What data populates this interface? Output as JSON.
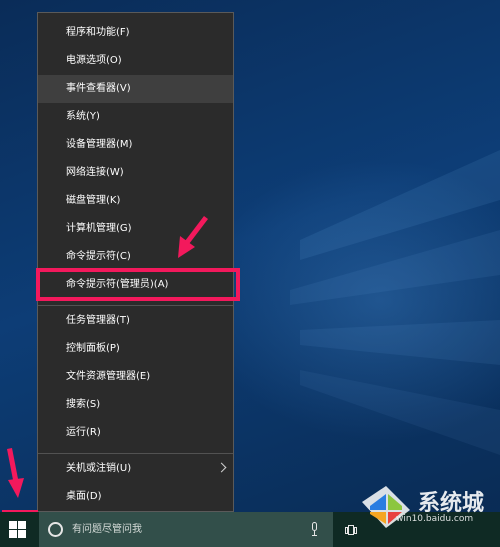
{
  "context_menu": {
    "items": [
      {
        "label": "程序和功能(F)"
      },
      {
        "label": "电源选项(O)"
      },
      {
        "label": "事件查看器(V)"
      },
      {
        "label": "系统(Y)"
      },
      {
        "label": "设备管理器(M)"
      },
      {
        "label": "网络连接(W)"
      },
      {
        "label": "磁盘管理(K)"
      },
      {
        "label": "计算机管理(G)"
      },
      {
        "label": "命令提示符(C)"
      },
      {
        "label": "命令提示符(管理员)(A)"
      },
      {
        "label": "任务管理器(T)"
      },
      {
        "label": "控制面板(P)"
      },
      {
        "label": "文件资源管理器(E)"
      },
      {
        "label": "搜索(S)"
      },
      {
        "label": "运行(R)"
      },
      {
        "label": "关机或注销(U)"
      },
      {
        "label": "桌面(D)"
      }
    ],
    "hovered_item": "事件查看器(V)",
    "highlighted_item": "命令提示符(管理员)(A)"
  },
  "taskbar": {
    "search_placeholder": "有问题尽管问我",
    "icons": [
      "windows-start-icon",
      "cortana-circle-icon",
      "microphone-icon",
      "task-view-icon"
    ]
  },
  "watermark": {
    "text": "win10.baidu.com",
    "icon": "windows-logo-watermark"
  },
  "colors": {
    "menu_bg": "#2b2b2b",
    "menu_hover": "#3f3f3f",
    "highlight": "#f3195c",
    "taskbar": "#0f2a24",
    "search_box": "#324f4a"
  }
}
